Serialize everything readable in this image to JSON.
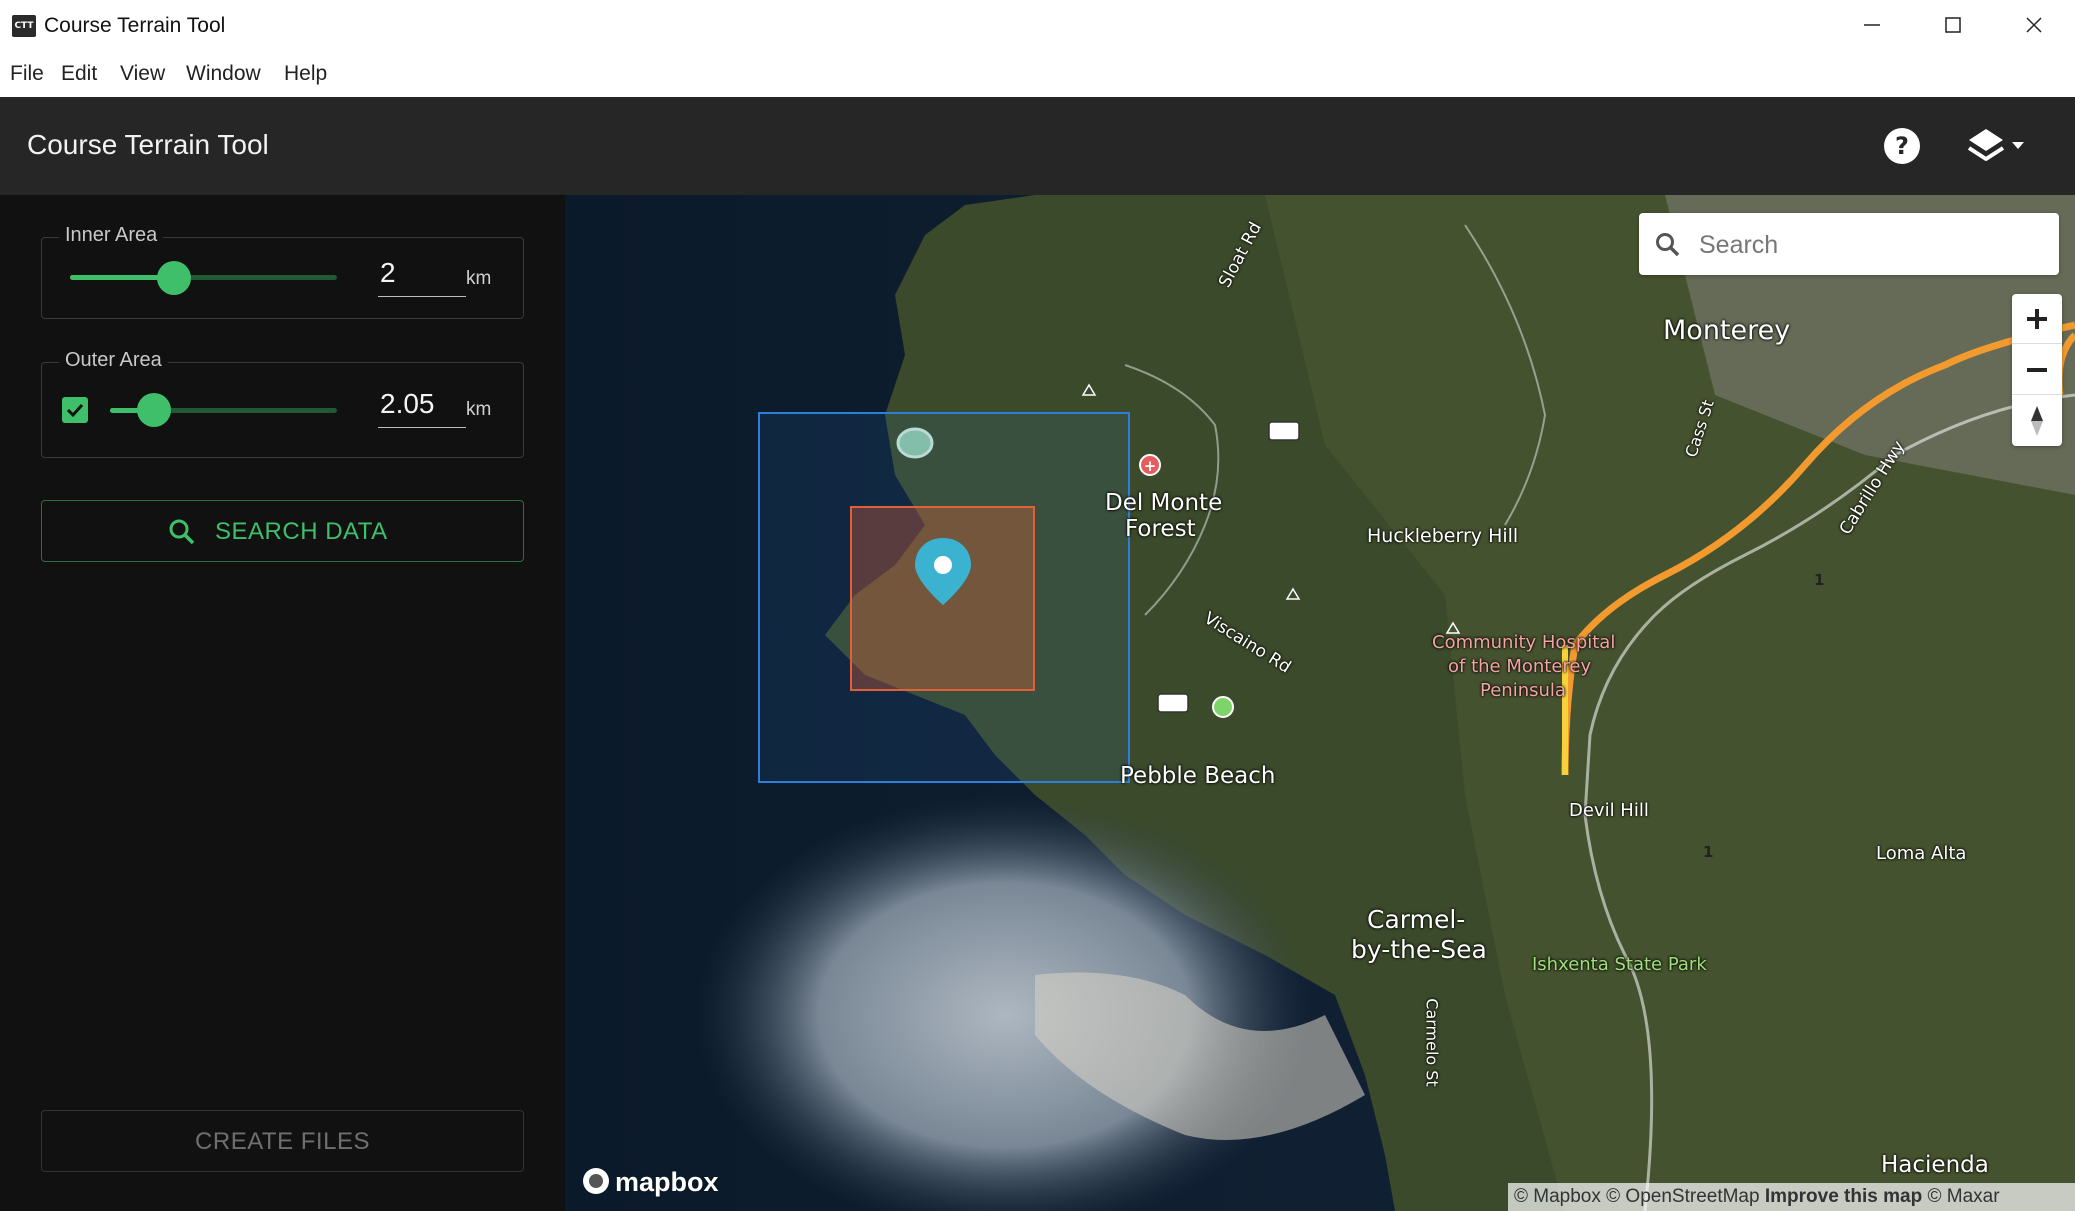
{
  "window": {
    "title": "Course Terrain Tool",
    "icon_text": "CTT",
    "controls": [
      "minimize-icon",
      "maximize-icon",
      "close-icon"
    ]
  },
  "menu": [
    "File",
    "Edit",
    "View",
    "Window",
    "Help"
  ],
  "appbar": {
    "title": "Course Terrain Tool",
    "help_icon": "help-circle-icon",
    "layers_icon": "layers-icon"
  },
  "sidebar": {
    "inner_area": {
      "legend": "Inner Area",
      "value": "2",
      "unit": "km",
      "slider_fraction": 0.39
    },
    "outer_area": {
      "legend": "Outer Area",
      "value": "2.05",
      "unit": "km",
      "checked": true,
      "slider_fraction": 0.2
    },
    "search_button": "SEARCH DATA",
    "create_button": "CREATE FILES"
  },
  "map": {
    "search_placeholder": "Search",
    "labels": {
      "monterey": "Monterey",
      "del_monte_1": "Del Monte",
      "del_monte_2": "Forest",
      "huckleberry": "Huckleberry Hill",
      "hospital_1": "Community Hospital",
      "hospital_2": "of the Monterey",
      "hospital_3": "Peninsula",
      "pebble_beach": "Pebble Beach",
      "carmel_1": "Carmel-",
      "carmel_2": "by-the-Sea",
      "devil_hill": "Devil Hill",
      "loma_alta": "Loma Alta",
      "ishxenta": "Ishxenta State Park",
      "hacienda": "Hacienda",
      "sloat_rd": "Sloat Rd",
      "viscaino_rd": "Viscaino Rd",
      "cass_st": "Cass St",
      "cabrillo_hwy": "Cabrillo Hwy",
      "carmelo_st": "Carmelo St",
      "route_1a": "1",
      "route_1b": "1"
    },
    "logo": "mapbox",
    "attribution": {
      "mapbox": "© Mapbox",
      "osm": "© OpenStreetMap",
      "improve": "Improve this map",
      "maxar": "© Maxar"
    },
    "colors": {
      "inner_box": "#e0603a",
      "outer_box": "#2f7fd8",
      "marker": "#3bb2d0",
      "accent": "#3fbf6a"
    }
  }
}
